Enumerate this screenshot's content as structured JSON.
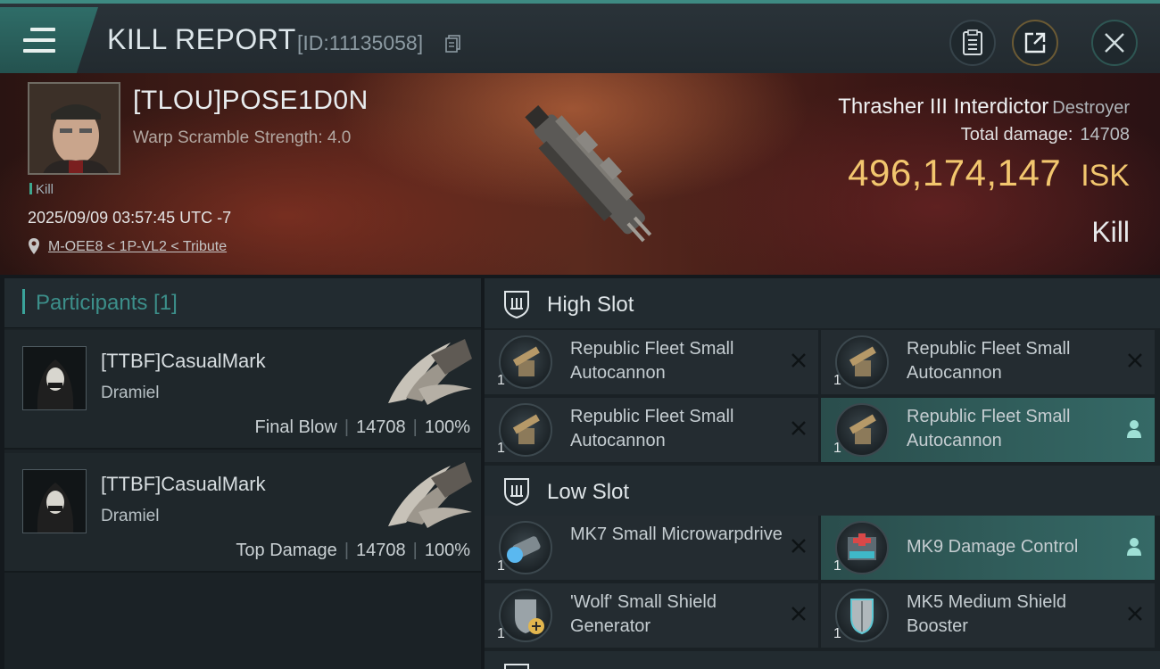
{
  "header": {
    "title": "KILL REPORT",
    "id_label": "[ID:11135058]"
  },
  "victim": {
    "name": "[TLOU]POSE1D0N",
    "attribute": "Warp Scramble Strength: 4.0",
    "tag": "Kill",
    "datetime": "2025/09/09 03:57:45 UTC -7",
    "location": "M-OEE8 < 1P-VL2 < Tribute",
    "ship": "Thrasher III Interdictor",
    "ship_class": "Destroyer",
    "total_damage_label": "Total damage:",
    "total_damage": "14708",
    "isk_value": "496,174,147",
    "isk_unit": "ISK",
    "result": "Kill"
  },
  "participants": {
    "title": "Participants [1]",
    "items": [
      {
        "name": "[TTBF]CasualMark",
        "ship": "Dramiel",
        "role": "Final Blow",
        "damage": "14708",
        "percent": "100%"
      },
      {
        "name": "[TTBF]CasualMark",
        "ship": "Dramiel",
        "role": "Top Damage",
        "damage": "14708",
        "percent": "100%"
      }
    ]
  },
  "fitting": {
    "high_slot": {
      "label": "High Slot",
      "modules": [
        {
          "name": "Republic Fleet Small Autocannon",
          "qty": "1",
          "status": "destroyed"
        },
        {
          "name": "Republic Fleet Small Autocannon",
          "qty": "1",
          "status": "destroyed"
        },
        {
          "name": "Republic Fleet Small Autocannon",
          "qty": "1",
          "status": "destroyed"
        },
        {
          "name": "Republic Fleet Small Autocannon",
          "qty": "1",
          "status": "dropped"
        }
      ]
    },
    "low_slot": {
      "label": "Low Slot",
      "modules": [
        {
          "name": "MK7 Small Microwarpdrive",
          "qty": "1",
          "status": "destroyed"
        },
        {
          "name": "MK9 Damage Control",
          "qty": "1",
          "status": "dropped"
        },
        {
          "name": "'Wolf' Small Shield Generator",
          "qty": "1",
          "status": "destroyed"
        },
        {
          "name": "MK5 Medium Shield Booster",
          "qty": "1",
          "status": "destroyed"
        }
      ]
    }
  },
  "colors": {
    "accent": "#3aa39a",
    "isk": "#f2c66e",
    "dropped_highlight": "#356966"
  },
  "icons": [
    "menu-icon",
    "copy-icon",
    "notes-icon",
    "share-icon",
    "close-icon",
    "location-pin-icon",
    "shield-slot-icon",
    "destroyed-x-icon",
    "dropped-person-icon"
  ]
}
